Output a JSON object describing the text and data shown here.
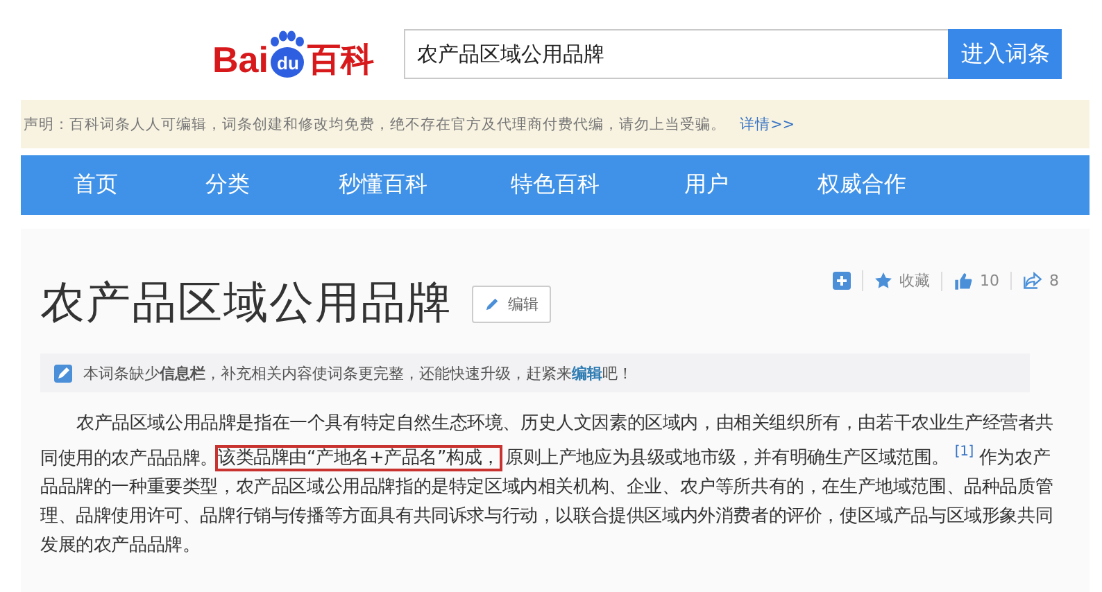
{
  "header": {
    "logo": {
      "left": "Bai",
      "paw": "du",
      "right": "百科"
    },
    "search": {
      "value": "农产品区域公用品牌"
    },
    "button": "进入词条"
  },
  "notice": {
    "text": "声明：百科词条人人可编辑，词条创建和修改均免费，绝不存在官方及代理商付费代编，请勿上当受骗。",
    "link": "详情>>"
  },
  "nav": [
    {
      "label": "首页",
      "selected": false
    },
    {
      "label": "分类",
      "selected": false
    },
    {
      "label": "秒懂百科",
      "selected": false
    },
    {
      "label": "特色百科",
      "selected": false
    },
    {
      "label": "用户",
      "selected": false
    },
    {
      "label": "权威合作",
      "selected": false
    }
  ],
  "article": {
    "actions": {
      "collect": "收藏",
      "likes": "10",
      "shares": "8"
    },
    "title": "农产品区域公用品牌",
    "edit_button": "编辑",
    "tip": {
      "before": "本词条缺少**信息栏**，补充相关内容使词条更完整，还能快速升级，赶紧来",
      "link": "编辑",
      "after": "吧！"
    },
    "paragraph": [
      {
        "text": "农产品区域公用品牌是指在一个具有特定自然生态环境、历史人文因素的区域内，由相关组织所有，由若干农业生产经营者共同使用的农产品品牌。",
        "highlighted": false
      },
      {
        "text": "该类品牌由“产地名+产品名”构成，",
        "highlighted": true
      },
      {
        "text": "原则上产地应为县级或地市级，并有明确生产区域范围。 $^{[1]}$  作为农产品品牌的一种重要类型，农产品区域公用品牌指的是特定区域内相关机构、企业、农户等所共有的，在生产地域范围、品种品质管理、品牌使用许可、品牌行销与传播等方面具有共同诉求与行动，以联合提供区域内外消费者的评价，使区域产品与区域形象共同发展的农产品品牌。",
        "highlighted": false
      }
    ]
  }
}
